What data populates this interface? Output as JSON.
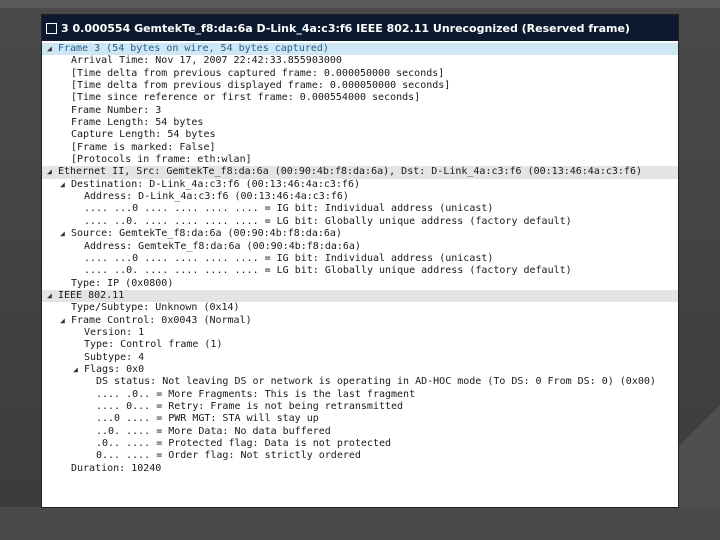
{
  "window": {
    "title": "3 0.000554 GemtekTe_f8:da:6a D-Link_4a:c3:f6 IEEE 802.11 Unrecognized (Reserved frame)"
  },
  "tree": [
    {
      "level": 0,
      "expander": "open",
      "style": "hl",
      "text": "Frame 3 (54 bytes on wire, 54 bytes captured)"
    },
    {
      "level": 1,
      "expander": "none",
      "style": "",
      "text": "Arrival Time: Nov 17, 2007 22:42:33.855903000"
    },
    {
      "level": 1,
      "expander": "none",
      "style": "",
      "text": "[Time delta from previous captured frame: 0.000050000 seconds]"
    },
    {
      "level": 1,
      "expander": "none",
      "style": "",
      "text": "[Time delta from previous displayed frame: 0.000050000 seconds]"
    },
    {
      "level": 1,
      "expander": "none",
      "style": "",
      "text": "[Time since reference or first frame: 0.000554000 seconds]"
    },
    {
      "level": 1,
      "expander": "none",
      "style": "",
      "text": "Frame Number: 3"
    },
    {
      "level": 1,
      "expander": "none",
      "style": "",
      "text": "Frame Length: 54 bytes"
    },
    {
      "level": 1,
      "expander": "none",
      "style": "",
      "text": "Capture Length: 54 bytes"
    },
    {
      "level": 1,
      "expander": "none",
      "style": "",
      "text": "[Frame is marked: False]"
    },
    {
      "level": 1,
      "expander": "none",
      "style": "",
      "text": "[Protocols in frame: eth:wlan]"
    },
    {
      "level": 0,
      "expander": "open",
      "style": "sel",
      "text": "Ethernet II, Src: GemtekTe_f8:da:6a (00:90:4b:f8:da:6a), Dst: D-Link_4a:c3:f6 (00:13:46:4a:c3:f6)"
    },
    {
      "level": 1,
      "expander": "open",
      "style": "",
      "text": "Destination: D-Link_4a:c3:f6 (00:13:46:4a:c3:f6)"
    },
    {
      "level": 2,
      "expander": "none",
      "style": "",
      "text": "Address: D-Link_4a:c3:f6 (00:13:46:4a:c3:f6)"
    },
    {
      "level": 2,
      "expander": "none",
      "style": "",
      "text": ".... ...0 .... .... .... .... = IG bit: Individual address (unicast)"
    },
    {
      "level": 2,
      "expander": "none",
      "style": "",
      "text": ".... ..0. .... .... .... .... = LG bit: Globally unique address (factory default)"
    },
    {
      "level": 1,
      "expander": "open",
      "style": "",
      "text": "Source: GemtekTe_f8:da:6a (00:90:4b:f8:da:6a)"
    },
    {
      "level": 2,
      "expander": "none",
      "style": "",
      "text": "Address: GemtekTe_f8:da:6a (00:90:4b:f8:da:6a)"
    },
    {
      "level": 2,
      "expander": "none",
      "style": "",
      "text": ".... ...0 .... .... .... .... = IG bit: Individual address (unicast)"
    },
    {
      "level": 2,
      "expander": "none",
      "style": "",
      "text": ".... ..0. .... .... .... .... = LG bit: Globally unique address (factory default)"
    },
    {
      "level": 1,
      "expander": "none",
      "style": "",
      "text": "Type: IP (0x0800)"
    },
    {
      "level": 0,
      "expander": "open",
      "style": "sel",
      "text": "IEEE 802.11"
    },
    {
      "level": 1,
      "expander": "none",
      "style": "",
      "text": "Type/Subtype: Unknown (0x14)"
    },
    {
      "level": 1,
      "expander": "open",
      "style": "",
      "text": "Frame Control: 0x0043 (Normal)"
    },
    {
      "level": 2,
      "expander": "none",
      "style": "",
      "text": "Version: 1"
    },
    {
      "level": 2,
      "expander": "none",
      "style": "",
      "text": "Type: Control frame (1)"
    },
    {
      "level": 2,
      "expander": "none",
      "style": "",
      "text": "Subtype: 4"
    },
    {
      "level": 2,
      "expander": "open",
      "style": "",
      "text": "Flags: 0x0"
    },
    {
      "level": 3,
      "expander": "none",
      "style": "",
      "text": "DS status: Not leaving DS or network is operating in AD-HOC mode (To DS: 0 From DS: 0) (0x00)"
    },
    {
      "level": 3,
      "expander": "none",
      "style": "",
      "text": ".... .0.. = More Fragments: This is the last fragment"
    },
    {
      "level": 3,
      "expander": "none",
      "style": "",
      "text": ".... 0... = Retry: Frame is not being retransmitted"
    },
    {
      "level": 3,
      "expander": "none",
      "style": "",
      "text": "...0 .... = PWR MGT: STA will stay up"
    },
    {
      "level": 3,
      "expander": "none",
      "style": "",
      "text": "..0. .... = More Data: No data buffered"
    },
    {
      "level": 3,
      "expander": "none",
      "style": "",
      "text": ".0.. .... = Protected flag: Data is not protected"
    },
    {
      "level": 3,
      "expander": "none",
      "style": "",
      "text": "0... .... = Order flag: Not strictly ordered"
    },
    {
      "level": 1,
      "expander": "none",
      "style": "",
      "text": "Duration: 10240"
    }
  ],
  "icons": {
    "expanded": "triangle-down-right",
    "title": "packet-icon"
  },
  "colors": {
    "titlebar": "#0b1a2e",
    "highlight_row": "#cfe6f5",
    "highlight_text": "#1f5f8b",
    "selected_row": "#e4e4e4",
    "background": "#3b3b3b"
  }
}
